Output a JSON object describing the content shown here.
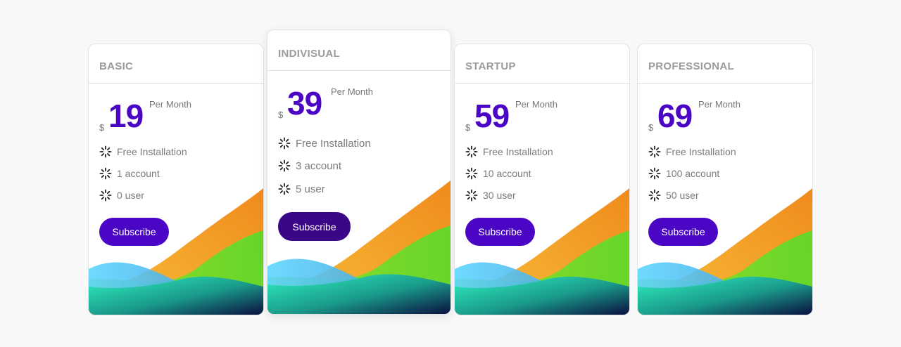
{
  "plans": [
    {
      "name": "BASIC",
      "currency": "$",
      "price": "19",
      "period": "Per Month",
      "features": [
        "Free Installation",
        "1 account",
        "0 user"
      ],
      "button_label": "Subscribe"
    },
    {
      "name": "INDIVISUAL",
      "currency": "$",
      "price": "39",
      "period": "Per Month",
      "features": [
        "Free Installation",
        "3 account",
        "5 user"
      ],
      "button_label": "Subscribe"
    },
    {
      "name": "STARTUP",
      "currency": "$",
      "price": "59",
      "period": "Per Month",
      "features": [
        "Free Installation",
        "10 account",
        "30 user"
      ],
      "button_label": "Subscribe"
    },
    {
      "name": "PROFESSIONAL",
      "currency": "$",
      "price": "69",
      "period": "Per Month",
      "features": [
        "Free Installation",
        "100 account",
        "50 user"
      ],
      "button_label": "Subscribe"
    }
  ],
  "icons": {
    "feature": "loading-spinner-icon"
  },
  "colors": {
    "accent": "#4a06c4",
    "accent_featured": "#3b0789",
    "plan_name": "#9b9b9b",
    "text": "#7a7a7a",
    "wave_orange": "#f5a623",
    "wave_green": "#6fe022",
    "wave_blue": "#4fc8f0",
    "wave_teal": "#2ee6b4"
  }
}
